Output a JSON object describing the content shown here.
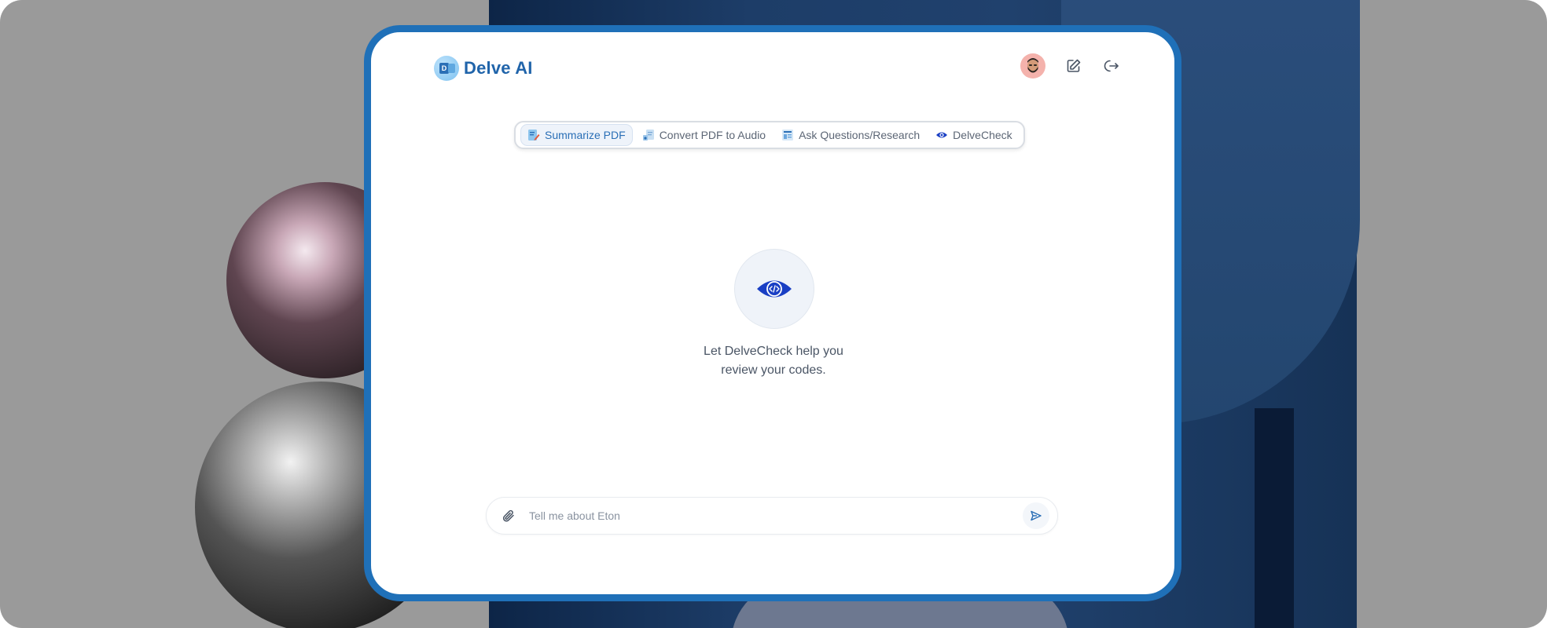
{
  "app": {
    "name": "Delve AI",
    "logo_letter": "D"
  },
  "tabs": [
    {
      "label": "Summarize PDF",
      "icon": "document-pen-icon",
      "active": true
    },
    {
      "label": "Convert PDF to Audio",
      "icon": "document-audio-icon",
      "active": false
    },
    {
      "label": "Ask Questions/Research",
      "icon": "document-layout-icon",
      "active": false
    },
    {
      "label": "DelveCheck",
      "icon": "eye-icon",
      "active": false
    }
  ],
  "hero": {
    "icon": "eye-code-icon",
    "line1": "Let DelveCheck help you",
    "line2": "review your codes."
  },
  "composer": {
    "placeholder": "Tell me about Eton",
    "attach_icon": "paperclip-icon",
    "send_icon": "send-icon"
  },
  "colors": {
    "accent": "#1f70b8",
    "brand_text": "#2064aa",
    "eye": "#1a3fc4",
    "avatar_bg": "#f4b2ac"
  }
}
